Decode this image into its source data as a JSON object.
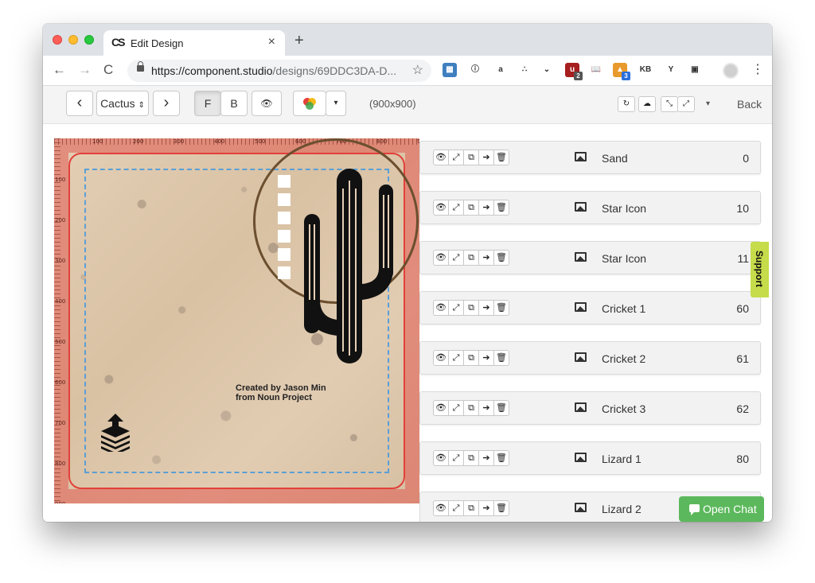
{
  "browser": {
    "tab_title": "Edit Design",
    "favicon_text": "CS",
    "close": "×",
    "new_tab": "+",
    "url_host": "https://component.studio",
    "url_path": "/designs/69DDC3DA-D...",
    "star": "☆",
    "extensions": [
      {
        "name": "extension-grid-icon",
        "color": "#3f7fbf",
        "text": "▦"
      },
      {
        "name": "onepassword-icon",
        "color": "#ffffff",
        "text": "ⓘ"
      },
      {
        "name": "amazon-icon",
        "color": "#ffffff",
        "text": "a"
      },
      {
        "name": "asana-icon",
        "color": "#ffffff",
        "text": "∴"
      },
      {
        "name": "pocket-icon",
        "color": "#ffffff",
        "text": "⌄"
      },
      {
        "name": "ublock-icon",
        "color": "#a61e1e",
        "text": "u",
        "badge": "2"
      },
      {
        "name": "book-icon",
        "color": "#ffffff",
        "text": "📖"
      },
      {
        "name": "blaze-icon",
        "color": "#e89a2c",
        "text": "▲",
        "badge": "3"
      },
      {
        "name": "kb-icon",
        "color": "#ffffff",
        "text": "KB"
      },
      {
        "name": "y-icon",
        "color": "#ffffff",
        "text": "Y"
      },
      {
        "name": "calendar-icon",
        "color": "#ffffff",
        "text": "▣"
      }
    ],
    "menu": "⋮"
  },
  "toolbar": {
    "prev": "‹",
    "design_select": "Cactus",
    "next": "›",
    "front": "F",
    "back_side": "B",
    "eye": "👁",
    "dimensions": "(900x900)",
    "refresh": "↻",
    "cloud": "☁",
    "shrink": "⤡",
    "expand": "⤢",
    "caret": "▾",
    "back_link": "Back"
  },
  "canvas": {
    "credit_line1": "Created by Jason Min",
    "credit_line2": "from Noun Project",
    "ruler_top": [
      "100",
      "200",
      "300",
      "400",
      "500",
      "600",
      "700",
      "800",
      "900"
    ],
    "ruler_left": [
      "100",
      "200",
      "300",
      "400",
      "500",
      "600",
      "700",
      "800",
      "900"
    ]
  },
  "layers": [
    {
      "name": "Sand",
      "z": "0"
    },
    {
      "name": "Star Icon",
      "z": "10"
    },
    {
      "name": "Star Icon",
      "z": "11"
    },
    {
      "name": "Cricket 1",
      "z": "60"
    },
    {
      "name": "Cricket 2",
      "z": "61"
    },
    {
      "name": "Cricket 3",
      "z": "62"
    },
    {
      "name": "Lizard 1",
      "z": "80"
    },
    {
      "name": "Lizard 2",
      "z": ""
    }
  ],
  "row_actions": {
    "eye": "👁",
    "move": "⤢",
    "copy": "⧉",
    "send": "➔",
    "delete": "🗑"
  },
  "support": "Support",
  "chat": "Open Chat",
  "colors": {
    "bleed": "#e15a50",
    "cut_line": "#e2403a",
    "safe_line": "#5a9fd6",
    "support": "#c6dc4a",
    "chat": "#5cb85c"
  }
}
